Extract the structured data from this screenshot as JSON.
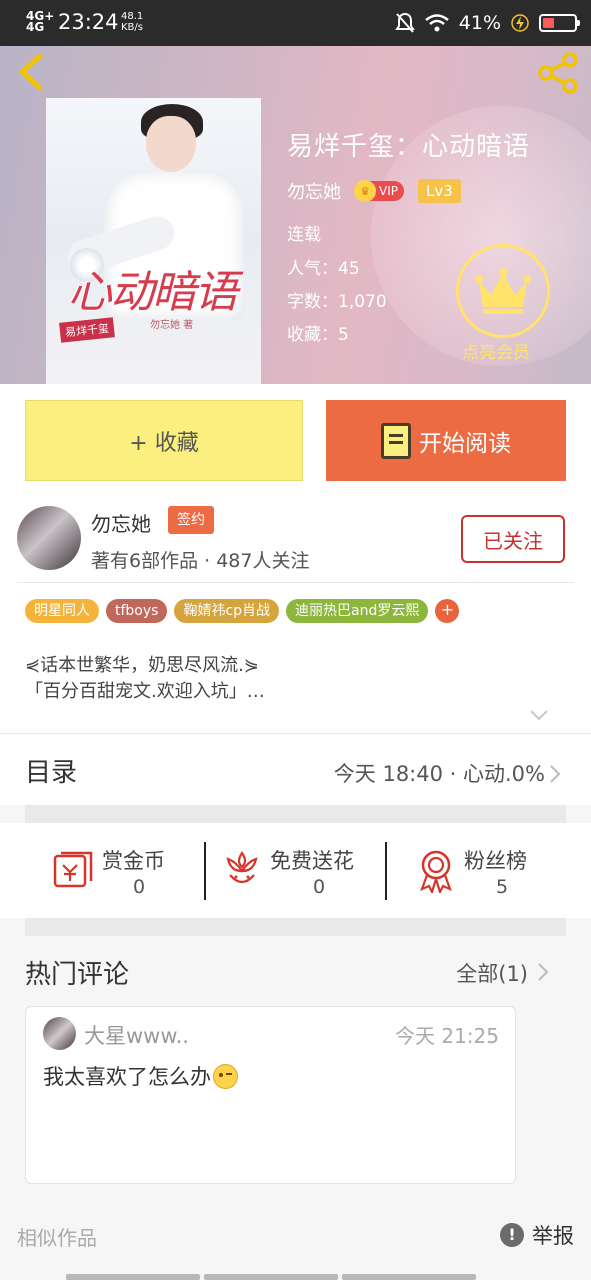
{
  "status_bar": {
    "network": "4G+",
    "network2": "4G",
    "time": "23:24",
    "speed_value": "48.1",
    "speed_unit": "KB/s",
    "battery": "41%"
  },
  "book": {
    "title": "易烊千玺：心动暗语",
    "cover_title": "心动暗语",
    "cover_tag": "易烊千玺",
    "cover_author": "勿忘她 著",
    "author": "勿忘她",
    "vip_label": "VIP",
    "level": "Lv3",
    "status": "连载",
    "popularity": "人气：45",
    "word_count": "字数：1,070",
    "favorites": "收藏：5",
    "vip_promo": "点亮会员"
  },
  "buttons": {
    "favorite": "+ 收藏",
    "start_reading": "开始阅读"
  },
  "author_card": {
    "name": "勿忘她",
    "badge": "签约",
    "stats": "著有6部作品 · 487人关注",
    "follow": "已关注"
  },
  "tags": [
    {
      "label": "明星同人",
      "color": "#f4b43c"
    },
    {
      "label": "tfboys",
      "color": "#c0685a"
    },
    {
      "label": "鞠婧祎cp肖战",
      "color": "#d6a43c"
    },
    {
      "label": "迪丽热巴and罗云熙",
      "color": "#8db63c"
    }
  ],
  "tag_add": "+",
  "intro": {
    "line1": "⋞话本世繁华，奶思尽风流.⋟",
    "line2": "「百分百甜宠文.欢迎入坑」…"
  },
  "toc": {
    "title": "目录",
    "latest": "今天 18:40 · 心动.0%"
  },
  "actions": [
    {
      "label": "赏金币",
      "value": "0",
      "icon": "red-envelope-icon"
    },
    {
      "label": "免费送花",
      "value": "0",
      "icon": "flower-icon"
    },
    {
      "label": "粉丝榜",
      "value": "5",
      "icon": "medal-icon"
    }
  ],
  "comments": {
    "title": "热门评论",
    "all": "全部(1)",
    "items": [
      {
        "user": "大星www..",
        "time": "今天 21:25",
        "text": "我太喜欢了怎么办"
      }
    ]
  },
  "footer": {
    "similar": "相似作品",
    "report": "举报"
  },
  "colors": {
    "accent_orange": "#ec6b42",
    "favorite_yellow": "#fbf07f",
    "follow_red": "#c8322e",
    "vip_gold": "#ffe36a"
  }
}
